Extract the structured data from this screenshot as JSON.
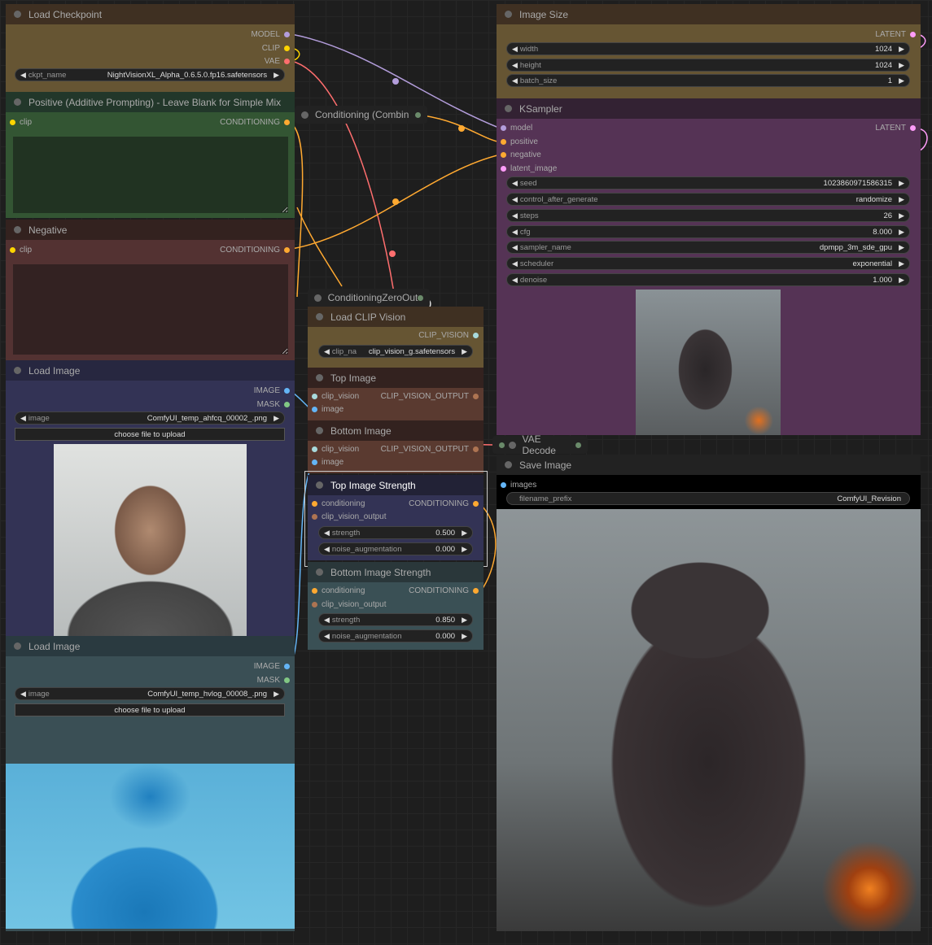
{
  "colors": {
    "model": "#b39ddb",
    "clip": "#ffd500",
    "vae": "#ff6e6e",
    "conditioning": "#ffa931",
    "latent": "#ff9cf9",
    "image": "#64b5f6",
    "mask": "#81c784",
    "clip_vision": "#a8dadc",
    "clip_vision_output": "#ad7452"
  },
  "load_checkpoint": {
    "title": "Load Checkpoint",
    "outputs": [
      "MODEL",
      "CLIP",
      "VAE"
    ],
    "ckpt_label": "ckpt_name",
    "ckpt_value": "NightVisionXL_Alpha_0.6.5.0.fp16.safetensors"
  },
  "positive": {
    "title": "Positive (Additive Prompting) - Leave Blank for Simple Mix",
    "input": "clip",
    "output": "CONDITIONING",
    "text": ""
  },
  "negative": {
    "title": "Negative",
    "input": "clip",
    "output": "CONDITIONING",
    "text": ""
  },
  "load_image_1": {
    "title": "Load Image",
    "outputs": [
      "IMAGE",
      "MASK"
    ],
    "image_label": "image",
    "image_value": "ComfyUI_temp_ahfcq_00002_.png",
    "upload": "choose file to upload"
  },
  "load_image_2": {
    "title": "Load Image",
    "outputs": [
      "IMAGE",
      "MASK"
    ],
    "image_label": "image",
    "image_value": "ComfyUI_temp_hvlog_00008_.png",
    "upload": "choose file to upload"
  },
  "conditioning_combine": {
    "title": "Conditioning (Combin"
  },
  "conditioning_zero_out": {
    "title": "ConditioningZeroOut"
  },
  "load_clip_vision": {
    "title": "Load CLIP Vision",
    "output": "CLIP_VISION",
    "clip_label": "clip_name",
    "clip_value": "clip_vision_g.safetensors"
  },
  "top_image": {
    "title": "Top Image",
    "inputs": [
      "clip_vision",
      "image"
    ],
    "output": "CLIP_VISION_OUTPUT"
  },
  "bottom_image": {
    "title": "Bottom Image",
    "inputs": [
      "clip_vision",
      "image"
    ],
    "output": "CLIP_VISION_OUTPUT"
  },
  "top_strength": {
    "title": "Top Image Strength",
    "inputs": [
      "conditioning",
      "clip_vision_output"
    ],
    "output": "CONDITIONING",
    "strength_label": "strength",
    "strength": "0.500",
    "noise_label": "noise_augmentation",
    "noise": "0.000"
  },
  "bottom_strength": {
    "title": "Bottom Image Strength",
    "inputs": [
      "conditioning",
      "clip_vision_output"
    ],
    "output": "CONDITIONING",
    "strength_label": "strength",
    "strength": "0.850",
    "noise_label": "noise_augmentation",
    "noise": "0.000"
  },
  "image_size": {
    "title": "Image Size",
    "output": "LATENT",
    "widgets": [
      {
        "label": "width",
        "value": "1024"
      },
      {
        "label": "height",
        "value": "1024"
      },
      {
        "label": "batch_size",
        "value": "1"
      }
    ]
  },
  "ksampler": {
    "title": "KSampler",
    "inputs": [
      "model",
      "positive",
      "negative",
      "latent_image"
    ],
    "output": "LATENT",
    "widgets": [
      {
        "label": "seed",
        "value": "1023860971586315"
      },
      {
        "label": "control_after_generate",
        "value": "randomize"
      },
      {
        "label": "steps",
        "value": "26"
      },
      {
        "label": "cfg",
        "value": "8.000"
      },
      {
        "label": "sampler_name",
        "value": "dpmpp_3m_sde_gpu"
      },
      {
        "label": "scheduler",
        "value": "exponential"
      },
      {
        "label": "denoise",
        "value": "1.000"
      }
    ]
  },
  "vae_decode": {
    "title": "VAE Decode"
  },
  "save_image": {
    "title": "Save Image",
    "input": "images",
    "prefix_label": "filename_prefix",
    "prefix_value": "ComfyUI_Revision"
  }
}
